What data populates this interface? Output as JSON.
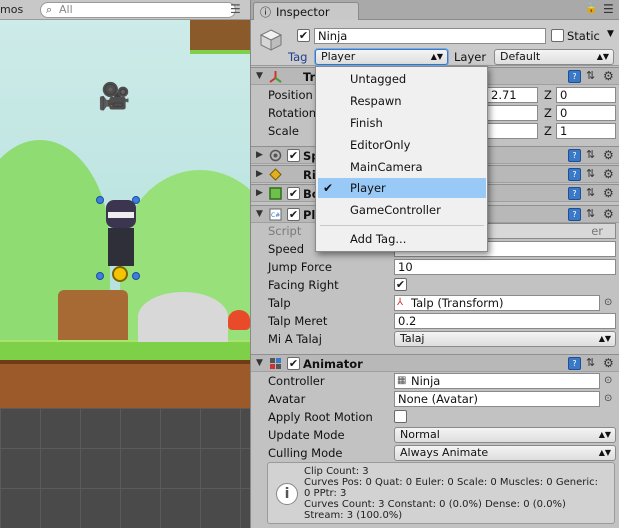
{
  "scene": {
    "tab_label": "mos",
    "search_placeholder": "All",
    "icons": {
      "search": "search-icon",
      "menu": "menu-icon",
      "camera": "camera-icon"
    }
  },
  "inspector": {
    "tab_label": "Inspector",
    "object": {
      "name": "Ninja",
      "active": true,
      "static_label": "Static",
      "static_checked": false,
      "tag_label": "Tag",
      "tag_value": "Player",
      "layer_label": "Layer",
      "layer_value": "Default"
    },
    "transform": {
      "name": "Tr",
      "position_label": "Position",
      "rotation_label": "Rotation",
      "scale_label": "Scale",
      "position": {
        "y_partial": "2.71",
        "z_label": "Z",
        "z": "0"
      },
      "rotation": {
        "z_label": "Z",
        "z": "0"
      },
      "scale": {
        "z_label": "Z",
        "z": "1"
      }
    },
    "components": [
      {
        "name": "Sp",
        "checked": true
      },
      {
        "name": "Ri",
        "checked": false
      },
      {
        "name": "Bo",
        "checked": true
      },
      {
        "name": "Pl",
        "checked": true
      }
    ],
    "player_script": {
      "script_label": "Script",
      "script_value_partial": "er",
      "speed_label": "Speed",
      "jump_force_label": "Jump Force",
      "jump_force": "10",
      "facing_right_label": "Facing Right",
      "facing_right": true,
      "talp_label": "Talp",
      "talp_value": "Talp (Transform)",
      "talp_meret_label": "Talp Meret",
      "talp_meret": "0.2",
      "mi_a_talaj_label": "Mi A Talaj",
      "mi_a_talaj": "Talaj"
    },
    "animator": {
      "name": "Animator",
      "checked": true,
      "controller_label": "Controller",
      "controller_value": "Ninja",
      "avatar_label": "Avatar",
      "avatar_value": "None (Avatar)",
      "apply_root_motion_label": "Apply Root Motion",
      "apply_root_motion": false,
      "update_mode_label": "Update Mode",
      "update_mode": "Normal",
      "culling_mode_label": "Culling Mode",
      "culling_mode": "Always Animate",
      "info": {
        "line1": "Clip Count: 3",
        "line2": "Curves Pos: 0 Quat: 0 Euler: 0 Scale: 0 Muscles: 0 Generic:",
        "line3": "0 PPtr: 3",
        "line4": "Curves Count: 3 Constant: 0 (0.0%) Dense: 0 (0.0%)",
        "line5": "Stream: 3 (100.0%)"
      }
    }
  },
  "tag_dropdown": {
    "items": [
      {
        "label": "Untagged",
        "selected": false
      },
      {
        "label": "Respawn",
        "selected": false
      },
      {
        "label": "Finish",
        "selected": false
      },
      {
        "label": "EditorOnly",
        "selected": false
      },
      {
        "label": "MainCamera",
        "selected": false
      },
      {
        "label": "Player",
        "selected": true
      },
      {
        "label": "GameController",
        "selected": false
      }
    ],
    "add_tag_label": "Add Tag...",
    "check_glyph": "✔"
  },
  "colors": {
    "selection": "#99c9f7",
    "help_icon_blue": "#3a78c8",
    "panel_bg": "#c2c2c2"
  }
}
